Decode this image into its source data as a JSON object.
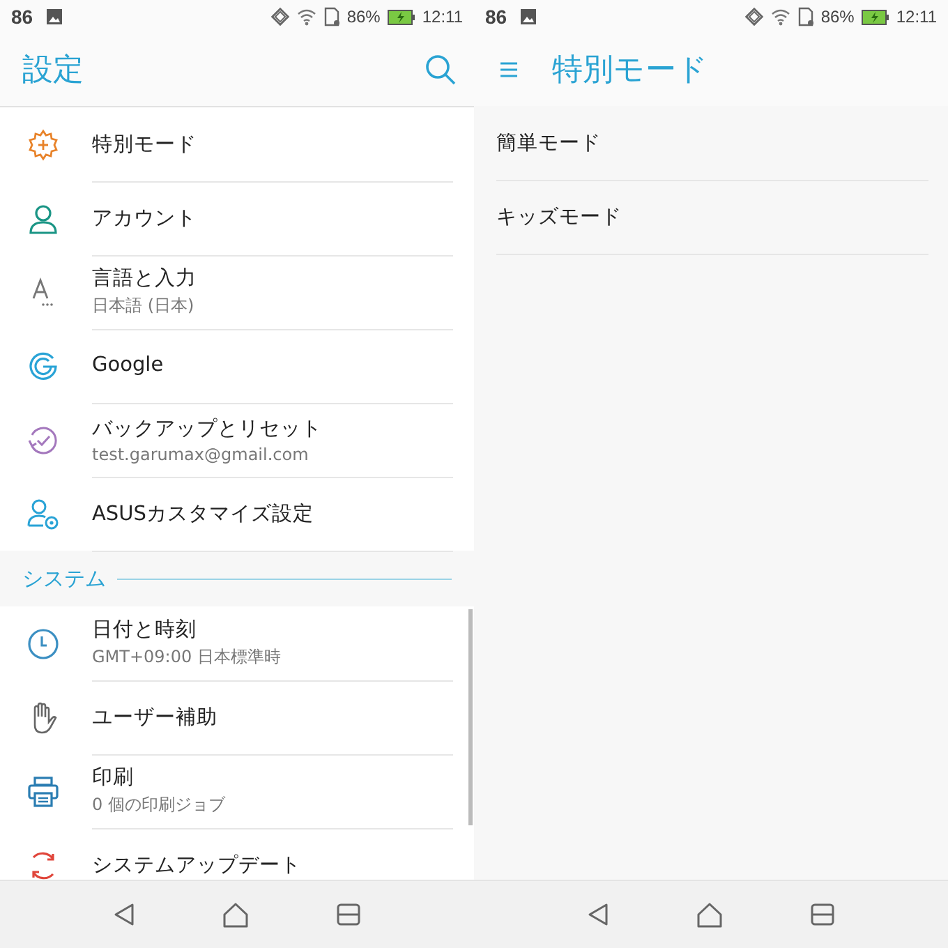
{
  "screens": [
    {
      "status_bar": {
        "notification_count": "86",
        "battery_percent": "86%",
        "time": "12:11"
      },
      "app_bar": {
        "title": "設定",
        "has_menu": false,
        "has_search": true
      },
      "sections": [
        {
          "items": [
            {
              "title": "特別モード"
            },
            {
              "title": "アカウント"
            },
            {
              "title": "言語と入力",
              "subtitle": "日本語 (日本)"
            },
            {
              "title": "Google"
            },
            {
              "title": "バックアップとリセット",
              "subtitle": "test.garumax@gmail.com"
            },
            {
              "title": "ASUSカスタマイズ設定"
            }
          ]
        },
        {
          "header": "システム",
          "items": [
            {
              "title": "日付と時刻",
              "subtitle": "GMT+09:00 日本標準時"
            },
            {
              "title": "ユーザー補助"
            },
            {
              "title": "印刷",
              "subtitle": "0 個の印刷ジョブ"
            },
            {
              "title": "システムアップデート"
            }
          ]
        }
      ]
    },
    {
      "status_bar": {
        "notification_count": "86",
        "battery_percent": "86%",
        "time": "12:11"
      },
      "app_bar": {
        "title": "特別モード",
        "has_menu": true,
        "has_search": false
      },
      "sections": [
        {
          "items": [
            {
              "title": "簡単モード"
            },
            {
              "title": "キッズモード"
            }
          ]
        }
      ]
    }
  ]
}
